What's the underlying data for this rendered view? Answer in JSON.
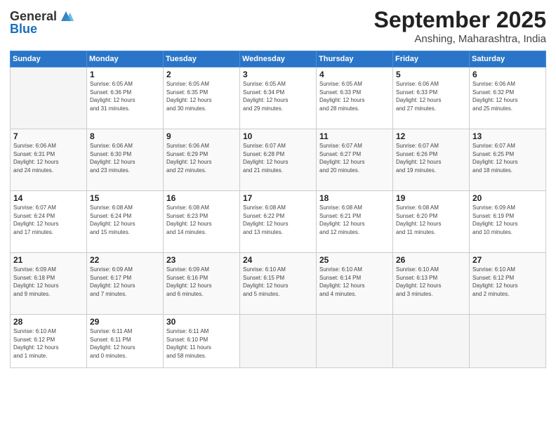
{
  "logo": {
    "line1": "General",
    "line2": "Blue"
  },
  "title": "September 2025",
  "subtitle": "Anshing, Maharashtra, India",
  "headers": [
    "Sunday",
    "Monday",
    "Tuesday",
    "Wednesday",
    "Thursday",
    "Friday",
    "Saturday"
  ],
  "weeks": [
    [
      {
        "day": "",
        "info": ""
      },
      {
        "day": "1",
        "info": "Sunrise: 6:05 AM\nSunset: 6:36 PM\nDaylight: 12 hours\nand 31 minutes."
      },
      {
        "day": "2",
        "info": "Sunrise: 6:05 AM\nSunset: 6:35 PM\nDaylight: 12 hours\nand 30 minutes."
      },
      {
        "day": "3",
        "info": "Sunrise: 6:05 AM\nSunset: 6:34 PM\nDaylight: 12 hours\nand 29 minutes."
      },
      {
        "day": "4",
        "info": "Sunrise: 6:05 AM\nSunset: 6:33 PM\nDaylight: 12 hours\nand 28 minutes."
      },
      {
        "day": "5",
        "info": "Sunrise: 6:06 AM\nSunset: 6:33 PM\nDaylight: 12 hours\nand 27 minutes."
      },
      {
        "day": "6",
        "info": "Sunrise: 6:06 AM\nSunset: 6:32 PM\nDaylight: 12 hours\nand 25 minutes."
      }
    ],
    [
      {
        "day": "7",
        "info": "Sunrise: 6:06 AM\nSunset: 6:31 PM\nDaylight: 12 hours\nand 24 minutes."
      },
      {
        "day": "8",
        "info": "Sunrise: 6:06 AM\nSunset: 6:30 PM\nDaylight: 12 hours\nand 23 minutes."
      },
      {
        "day": "9",
        "info": "Sunrise: 6:06 AM\nSunset: 6:29 PM\nDaylight: 12 hours\nand 22 minutes."
      },
      {
        "day": "10",
        "info": "Sunrise: 6:07 AM\nSunset: 6:28 PM\nDaylight: 12 hours\nand 21 minutes."
      },
      {
        "day": "11",
        "info": "Sunrise: 6:07 AM\nSunset: 6:27 PM\nDaylight: 12 hours\nand 20 minutes."
      },
      {
        "day": "12",
        "info": "Sunrise: 6:07 AM\nSunset: 6:26 PM\nDaylight: 12 hours\nand 19 minutes."
      },
      {
        "day": "13",
        "info": "Sunrise: 6:07 AM\nSunset: 6:25 PM\nDaylight: 12 hours\nand 18 minutes."
      }
    ],
    [
      {
        "day": "14",
        "info": "Sunrise: 6:07 AM\nSunset: 6:24 PM\nDaylight: 12 hours\nand 17 minutes."
      },
      {
        "day": "15",
        "info": "Sunrise: 6:08 AM\nSunset: 6:24 PM\nDaylight: 12 hours\nand 15 minutes."
      },
      {
        "day": "16",
        "info": "Sunrise: 6:08 AM\nSunset: 6:23 PM\nDaylight: 12 hours\nand 14 minutes."
      },
      {
        "day": "17",
        "info": "Sunrise: 6:08 AM\nSunset: 6:22 PM\nDaylight: 12 hours\nand 13 minutes."
      },
      {
        "day": "18",
        "info": "Sunrise: 6:08 AM\nSunset: 6:21 PM\nDaylight: 12 hours\nand 12 minutes."
      },
      {
        "day": "19",
        "info": "Sunrise: 6:08 AM\nSunset: 6:20 PM\nDaylight: 12 hours\nand 11 minutes."
      },
      {
        "day": "20",
        "info": "Sunrise: 6:09 AM\nSunset: 6:19 PM\nDaylight: 12 hours\nand 10 minutes."
      }
    ],
    [
      {
        "day": "21",
        "info": "Sunrise: 6:09 AM\nSunset: 6:18 PM\nDaylight: 12 hours\nand 9 minutes."
      },
      {
        "day": "22",
        "info": "Sunrise: 6:09 AM\nSunset: 6:17 PM\nDaylight: 12 hours\nand 7 minutes."
      },
      {
        "day": "23",
        "info": "Sunrise: 6:09 AM\nSunset: 6:16 PM\nDaylight: 12 hours\nand 6 minutes."
      },
      {
        "day": "24",
        "info": "Sunrise: 6:10 AM\nSunset: 6:15 PM\nDaylight: 12 hours\nand 5 minutes."
      },
      {
        "day": "25",
        "info": "Sunrise: 6:10 AM\nSunset: 6:14 PM\nDaylight: 12 hours\nand 4 minutes."
      },
      {
        "day": "26",
        "info": "Sunrise: 6:10 AM\nSunset: 6:13 PM\nDaylight: 12 hours\nand 3 minutes."
      },
      {
        "day": "27",
        "info": "Sunrise: 6:10 AM\nSunset: 6:12 PM\nDaylight: 12 hours\nand 2 minutes."
      }
    ],
    [
      {
        "day": "28",
        "info": "Sunrise: 6:10 AM\nSunset: 6:12 PM\nDaylight: 12 hours\nand 1 minute."
      },
      {
        "day": "29",
        "info": "Sunrise: 6:11 AM\nSunset: 6:11 PM\nDaylight: 12 hours\nand 0 minutes."
      },
      {
        "day": "30",
        "info": "Sunrise: 6:11 AM\nSunset: 6:10 PM\nDaylight: 11 hours\nand 58 minutes."
      },
      {
        "day": "",
        "info": ""
      },
      {
        "day": "",
        "info": ""
      },
      {
        "day": "",
        "info": ""
      },
      {
        "day": "",
        "info": ""
      }
    ]
  ]
}
